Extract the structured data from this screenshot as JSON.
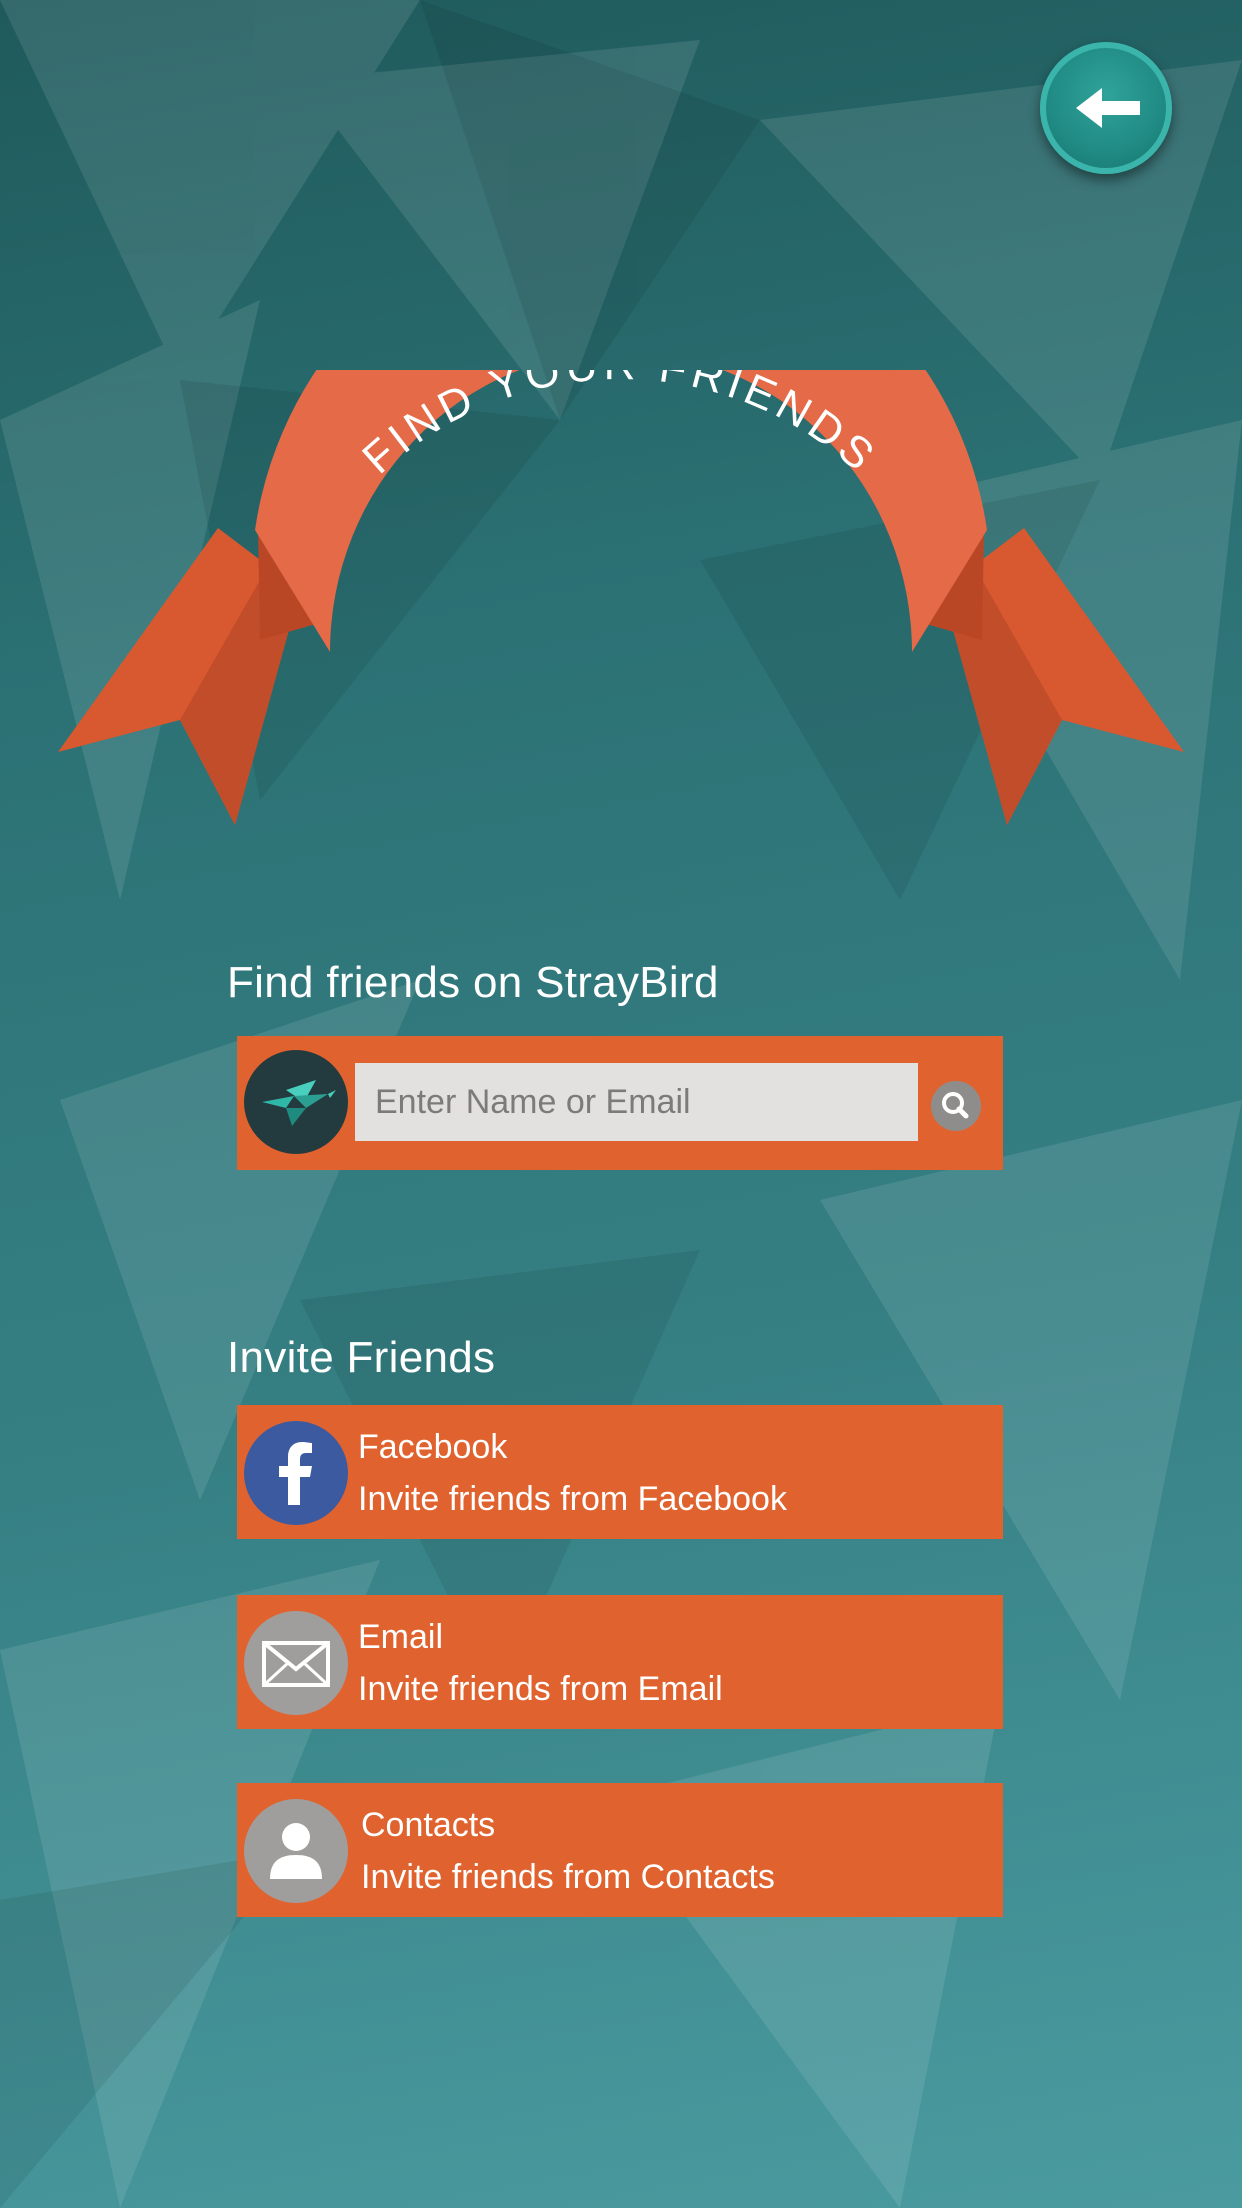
{
  "banner": {
    "title": "FIND YOUR FRIENDS"
  },
  "find_section": {
    "heading": "Find friends on StrayBird",
    "search_placeholder": "Enter Name or Email"
  },
  "invite_section": {
    "heading": "Invite Friends",
    "items": [
      {
        "title": "Facebook",
        "subtitle": "Invite friends from Facebook",
        "icon": "facebook-icon"
      },
      {
        "title": "Email",
        "subtitle": "Invite friends from Email",
        "icon": "envelope-icon"
      },
      {
        "title": "Contacts",
        "subtitle": "Invite friends from Contacts",
        "icon": "person-icon"
      }
    ]
  },
  "icons": {
    "back": "left-arrow-icon",
    "search": "magnifier-icon",
    "app_logo": "hummingbird-icon"
  },
  "colors": {
    "background": "#2c7275",
    "accent_orange": "#e0632f",
    "ribbon": "#e56a48",
    "back_button": "#208b84",
    "facebook_blue": "#3b5aa0",
    "icon_grey": "#a09e9c",
    "input_bg": "#e3e1df"
  }
}
